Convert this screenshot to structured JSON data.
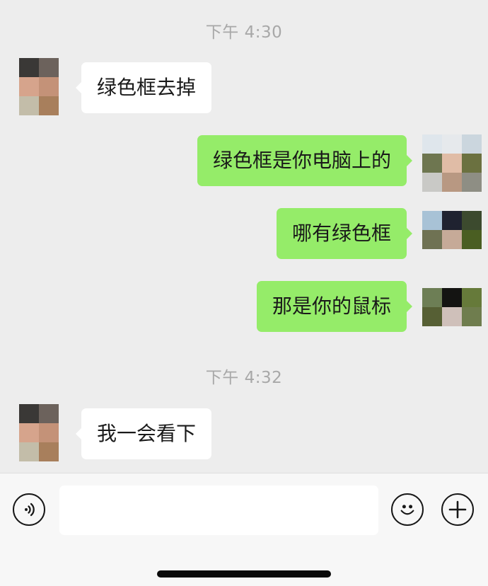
{
  "timestamps": [
    "下午 4:30",
    "下午 4:32"
  ],
  "messages": [
    {
      "side": "left",
      "text": "绿色框去掉"
    },
    {
      "side": "right",
      "text": "绿色框是你电脑上的"
    },
    {
      "side": "right",
      "text": "哪有绿色框"
    },
    {
      "side": "right",
      "text": "那是你的鼠标"
    },
    {
      "side": "left",
      "text": "我一会看下"
    }
  ],
  "input": {
    "value": "",
    "placeholder": ""
  },
  "icons": {
    "voice": "voice-icon",
    "emoji": "emoji-icon",
    "add": "plus-icon"
  },
  "colors": {
    "background": "#ededed",
    "sent_bubble": "#95ec69",
    "received_bubble": "#ffffff",
    "timestamp": "#a8a8a8"
  },
  "avatars": {
    "contact": [
      "#3a3836",
      "#6c625c",
      "#d6a48c",
      "#c49278",
      "#c3bda9",
      "#a87f5c"
    ],
    "self_1": [
      "#dfe6ec",
      "#e6e9ec",
      "#cbd6de",
      "#6e7650",
      "#e0bca6",
      "#6b7140",
      "#c9c9c6",
      "#b89882",
      "#8e8e84"
    ],
    "self_2": [
      "#a8c2d6",
      "#1f2230",
      "#3c4a2e",
      "#6f7253",
      "#c6aa98",
      "#4a5e22"
    ],
    "self_3": [
      "#6d7e55",
      "#141412",
      "#667a3a",
      "#565f34",
      "#cfc0ba",
      "#6f7d4e"
    ]
  }
}
